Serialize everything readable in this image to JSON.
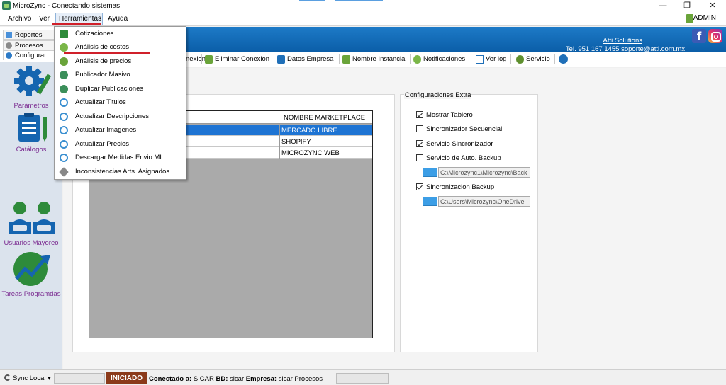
{
  "window": {
    "title": "MicroZync - Conectando sistemas",
    "controls": {
      "minimize": "—",
      "restore": "❐",
      "close": "✕"
    }
  },
  "menubar": {
    "items": [
      "Archivo",
      "Ver",
      "Herramientas",
      "Ayuda"
    ],
    "user": "ADMIN"
  },
  "left_tabs": [
    "Reportes",
    "Procesos",
    "Configurar"
  ],
  "left_panel": [
    "Parámetros",
    "Catálogos",
    "Usuarios Mayoreo",
    "Tareas Programdas"
  ],
  "header": {
    "company_link": "Atti Solutions",
    "contact": "Tel. 951 167 1455  soporte@atti.com.mx"
  },
  "toolbar": {
    "items": [
      "nexion",
      "Eliminar Conexion",
      "Datos Empresa",
      "Nombre Instancia",
      "Notificaciones",
      "Ver log",
      "Servicio"
    ]
  },
  "dropdown": {
    "items": [
      "Cotizaciones",
      "Análisis de costos",
      "Análisis de precios",
      "Publicador Masivo",
      "Duplicar Publicaciones",
      "Actualizar Titulos",
      "Actualizar Descripciones",
      "Actualizar Imagenes",
      "Actualizar Precios",
      "Descargar Medidas Envio ML",
      "Inconsistencias Arts. Asignados"
    ]
  },
  "grid": {
    "column_header": "NOMBRE MARKETPLACE",
    "rows": [
      "MERCADO LIBRE",
      "SHOPIFY",
      "MICROZYNC WEB"
    ],
    "selected_index": 0
  },
  "config_extra": {
    "title": "Configuraciones Extra",
    "checkboxes": [
      {
        "label": "Mostrar Tablero",
        "checked": true
      },
      {
        "label": "Sincronizador Secuencial",
        "checked": false
      },
      {
        "label": "Servicio Sincronizador",
        "checked": true
      },
      {
        "label": "Servicio de Auto. Backup",
        "checked": false
      },
      {
        "label": "Sincronizacion Backup",
        "checked": true
      }
    ],
    "browse_label": "...",
    "paths": [
      "C:\\Microzync1\\Microzync\\Back",
      "C:\\Users\\Microzync\\OneDrive"
    ]
  },
  "statusbar": {
    "sync": "Sync Local",
    "sync_arrow": "▾",
    "state": "INICIADO",
    "connected_label": "Conectado a:",
    "connected_value": "SICAR",
    "db_label": "BD:",
    "db_value": "sicar",
    "company_label": "Empresa:",
    "company_value": "sicar",
    "process": "Procesos"
  },
  "colors": {
    "header_blue": "#0b5ea8",
    "selection": "#1e74d3",
    "panel_text": "#7a2a90",
    "status_iniciado": "#8b3a1a",
    "menu_underline": "#d0202a"
  }
}
